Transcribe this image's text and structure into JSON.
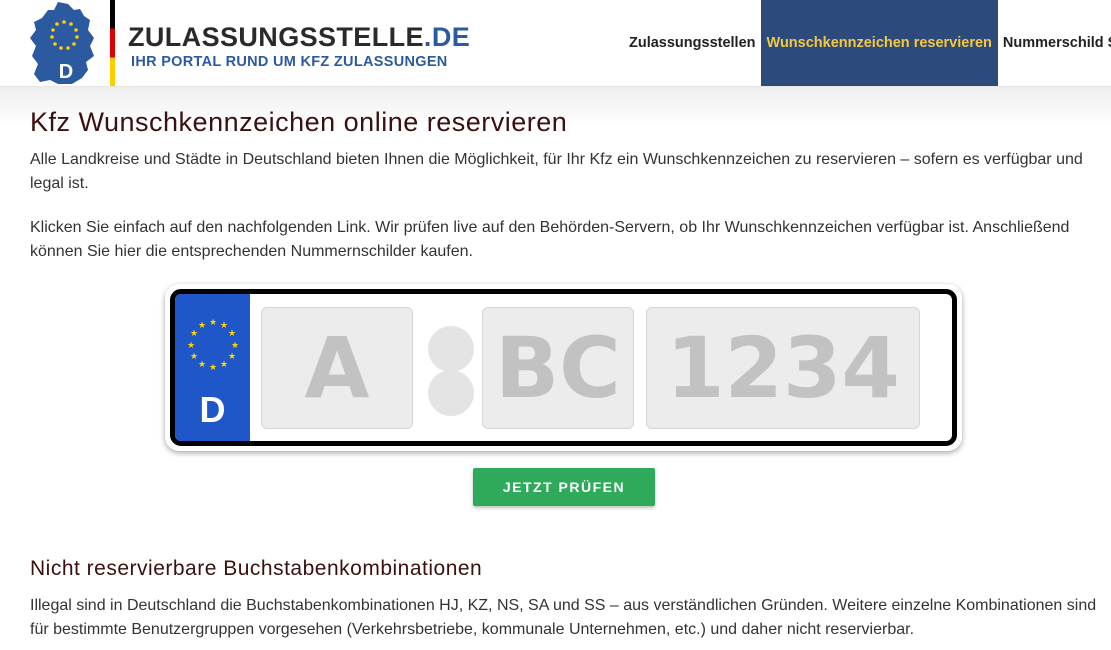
{
  "header": {
    "brand_name": "ZULASSUNGSSTELLE",
    "brand_tld": ".DE",
    "brand_tagline": "IHR PORTAL RUND UM KFZ ZULASSUNGEN",
    "logo_letter": "D"
  },
  "nav": {
    "items": [
      {
        "label": "Zulassungsstellen",
        "active": false
      },
      {
        "label": "Wunschkennzeichen reservieren",
        "active": true
      },
      {
        "label": "Nummerschild S",
        "active": false
      }
    ],
    "active_bg": "#2d4a7c",
    "active_color": "#f5c842"
  },
  "main": {
    "title": "Kfz Wunschkennzeichen online reservieren",
    "intro": "Alle Landkreise und Städte in Deutschland bieten Ihnen die Möglichkeit, für Ihr Kfz ein Wunschkennzeichen zu reservieren – sofern es verfügbar und legal ist.",
    "instructions": "Klicken Sie einfach auf den nachfolgenden Link. Wir prüfen live auf den Behörden-Servern, ob Ihr Wunschkennzeichen verfügbar ist. Anschließend können Sie hier die entsprechenden Nummernschilder kaufen."
  },
  "plate": {
    "country_code": "D",
    "district_placeholder": "A",
    "letters_placeholder": "BC",
    "numbers_placeholder": "1234",
    "eu_blue": "#1f56c8"
  },
  "check_button": {
    "label": "JETZT PRÜFEN",
    "color": "#2eaa5a"
  },
  "section2": {
    "title": "Nicht reservierbare Buchstabenkombinationen",
    "text": "Illegal sind in Deutschland die Buchstabenkombinationen HJ, KZ, NS, SA und SS – aus verständlichen Gründen. Weitere einzelne Kombinationen sind für bestimmte Benutzergruppen vorgesehen (Verkehrsbetriebe, kommunale Unternehmen, etc.) und daher nicht reservierbar."
  }
}
